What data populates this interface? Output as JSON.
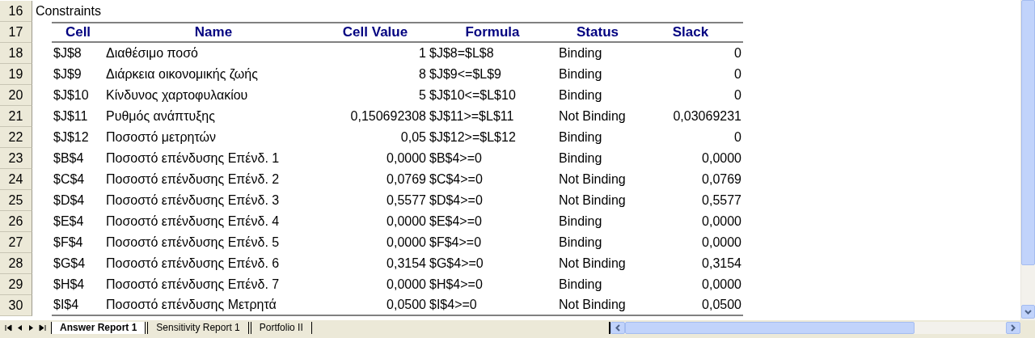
{
  "sheet": {
    "title_row": {
      "number": "16",
      "text": "Constraints"
    },
    "header_row": {
      "number": "17"
    },
    "columns": [
      {
        "label": "Cell"
      },
      {
        "label": "Name"
      },
      {
        "label": "Cell Value"
      },
      {
        "label": "Formula"
      },
      {
        "label": "Status"
      },
      {
        "label": "Slack"
      }
    ],
    "rows": [
      {
        "number": "18",
        "cells": [
          "$J$8",
          "Διαθέσιμο ποσό",
          "1",
          "$J$8=$L$8",
          "Binding",
          "0"
        ]
      },
      {
        "number": "19",
        "cells": [
          "$J$9",
          "Διάρκεια οικονομικής ζωής",
          "8",
          "$J$9<=$L$9",
          "Binding",
          "0"
        ]
      },
      {
        "number": "20",
        "cells": [
          "$J$10",
          "Κίνδυνος χαρτοφυλακίου",
          "5",
          "$J$10<=$L$10",
          "Binding",
          "0"
        ]
      },
      {
        "number": "21",
        "cells": [
          "$J$11",
          "Ρυθμός ανάπτυξης",
          "0,150692308",
          "$J$11>=$L$11",
          "Not Binding",
          "0,03069231"
        ]
      },
      {
        "number": "22",
        "cells": [
          "$J$12",
          "Ποσοστό μετρητών",
          "0,05",
          "$J$12>=$L$12",
          "Binding",
          "0"
        ]
      },
      {
        "number": "23",
        "cells": [
          "$B$4",
          "Ποσοστό επένδυσης Επένδ. 1",
          "0,0000",
          "$B$4>=0",
          "Binding",
          "0,0000"
        ]
      },
      {
        "number": "24",
        "cells": [
          "$C$4",
          "Ποσοστό επένδυσης Επένδ. 2",
          "0,0769",
          "$C$4>=0",
          "Not Binding",
          "0,0769"
        ]
      },
      {
        "number": "25",
        "cells": [
          "$D$4",
          "Ποσοστό επένδυσης Επένδ. 3",
          "0,5577",
          "$D$4>=0",
          "Not Binding",
          "0,5577"
        ]
      },
      {
        "number": "26",
        "cells": [
          "$E$4",
          "Ποσοστό επένδυσης Επένδ. 4",
          "0,0000",
          "$E$4>=0",
          "Binding",
          "0,0000"
        ]
      },
      {
        "number": "27",
        "cells": [
          "$F$4",
          "Ποσοστό επένδυσης Επένδ. 5",
          "0,0000",
          "$F$4>=0",
          "Binding",
          "0,0000"
        ]
      },
      {
        "number": "28",
        "cells": [
          "$G$4",
          "Ποσοστό επένδυσης Επένδ. 6",
          "0,3154",
          "$G$4>=0",
          "Not Binding",
          "0,3154"
        ]
      },
      {
        "number": "29",
        "cells": [
          "$H$4",
          "Ποσοστό επένδυσης Επένδ. 7",
          "0,0000",
          "$H$4>=0",
          "Binding",
          "0,0000"
        ]
      },
      {
        "number": "30",
        "cells": [
          "$I$4",
          "Ποσοστό επένδυσης Μετρητά",
          "0,0500",
          "$I$4>=0",
          "Not Binding",
          "0,0500"
        ]
      }
    ]
  },
  "tabs": [
    {
      "label": "Answer Report 1",
      "selected": true
    },
    {
      "label": "Sensitivity Report 1",
      "selected": false
    },
    {
      "label": "Portfolio II",
      "selected": false
    }
  ]
}
